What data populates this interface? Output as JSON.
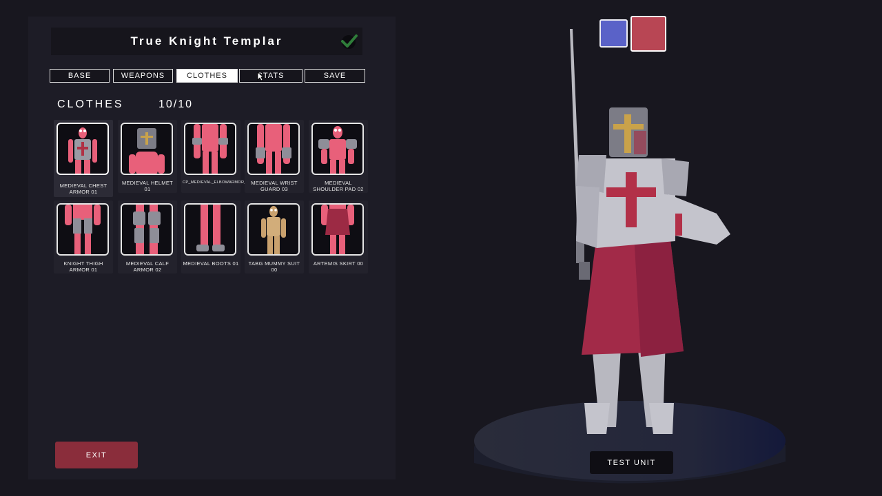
{
  "header": {
    "title": "True Knight Templar",
    "confirm_icon": "checkmark-icon"
  },
  "tabs": [
    {
      "label": "BASE",
      "active": false
    },
    {
      "label": "WEAPONS",
      "active": false
    },
    {
      "label": "CLOTHES",
      "active": true
    },
    {
      "label": "STATS",
      "active": false
    },
    {
      "label": "SAVE",
      "active": false
    }
  ],
  "section": {
    "label": "CLOTHES",
    "count": "10/10"
  },
  "items": [
    {
      "label": "MEDIEVAL CHEST ARMOR 01",
      "selected": true
    },
    {
      "label": "MEDIEVAL HELMET 01",
      "selected": false
    },
    {
      "label": "CP_MEDIEVAL_ELBOWARMOR_BOTH",
      "selected": false
    },
    {
      "label": "MEDIEVAL WRIST GUARD 03",
      "selected": false
    },
    {
      "label": "MEDIEVAL SHOULDER PAD 02",
      "selected": false
    },
    {
      "label": "KNIGHT THIGH ARMOR 01",
      "selected": false
    },
    {
      "label": "MEDIEVAL CALF ARMOR 02",
      "selected": false
    },
    {
      "label": "MEDIEVAL BOOTS 01",
      "selected": false
    },
    {
      "label": "TABG MUMMY SUIT 00",
      "selected": false
    },
    {
      "label": "ARTEMIS SKIRT 00",
      "selected": false
    }
  ],
  "exit_label": "EXIT",
  "test_unit_label": "TEST UNIT",
  "colors": {
    "primary": "#5a62c8",
    "secondary": "#b84654",
    "accent": "#8a2d3b"
  }
}
